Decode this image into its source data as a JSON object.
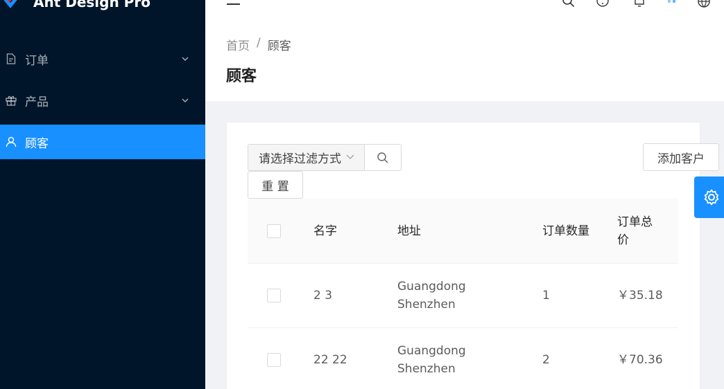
{
  "app": {
    "title": "Ant Design Pro"
  },
  "sidebar": {
    "items": [
      {
        "label": "订单",
        "icon": "file-icon",
        "expandable": true
      },
      {
        "label": "产品",
        "icon": "gift-icon",
        "expandable": true
      },
      {
        "label": "顾客",
        "icon": "user-icon",
        "active": true
      }
    ]
  },
  "header": {
    "icons": [
      "menu-fold-icon",
      "search-icon",
      "question-icon",
      "bell-icon",
      "avatar",
      "globe-icon"
    ]
  },
  "page": {
    "breadcrumb": [
      "首页",
      "/",
      "顾客"
    ],
    "title": "顾客"
  },
  "toolbar": {
    "filter_placeholder": "请选择过滤方式",
    "reset_label": "重 置",
    "add_label": "添加客户"
  },
  "table": {
    "columns": [
      "名字",
      "地址",
      "订单数量",
      "订单总价"
    ],
    "rows": [
      {
        "name": "2 3",
        "address": "Guangdong Shenzhen",
        "order_count": "1",
        "order_total": "￥35.18"
      },
      {
        "name": "22 22",
        "address": "Guangdong Shenzhen",
        "order_count": "2",
        "order_total": "￥70.36"
      }
    ]
  },
  "colors": {
    "sider": "#001529",
    "primary": "#1890ff"
  }
}
